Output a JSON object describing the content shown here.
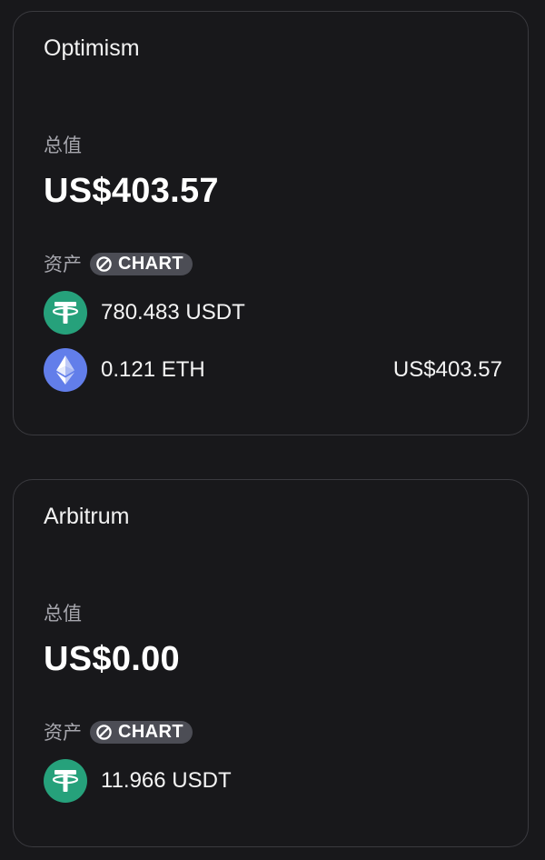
{
  "networks": [
    {
      "name": "Optimism",
      "total_label": "总值",
      "total_value": "US$403.57",
      "assets_label": "资产",
      "chart_badge": "CHART",
      "tokens": [
        {
          "amount": "780.483 USDT",
          "icon": "usdt-icon",
          "value": ""
        },
        {
          "amount": "0.121 ETH",
          "icon": "eth-icon",
          "value": "US$403.57"
        }
      ]
    },
    {
      "name": "Arbitrum",
      "total_label": "总值",
      "total_value": "US$0.00",
      "assets_label": "资产",
      "chart_badge": "CHART",
      "tokens": [
        {
          "amount": "11.966 USDT",
          "icon": "usdt-icon",
          "value": ""
        }
      ]
    }
  ],
  "colors": {
    "background": "#18181b",
    "card_border": "#3a3a3f",
    "usdt": "#26a17b",
    "eth": "#627eea",
    "badge": "#4c4d55"
  }
}
